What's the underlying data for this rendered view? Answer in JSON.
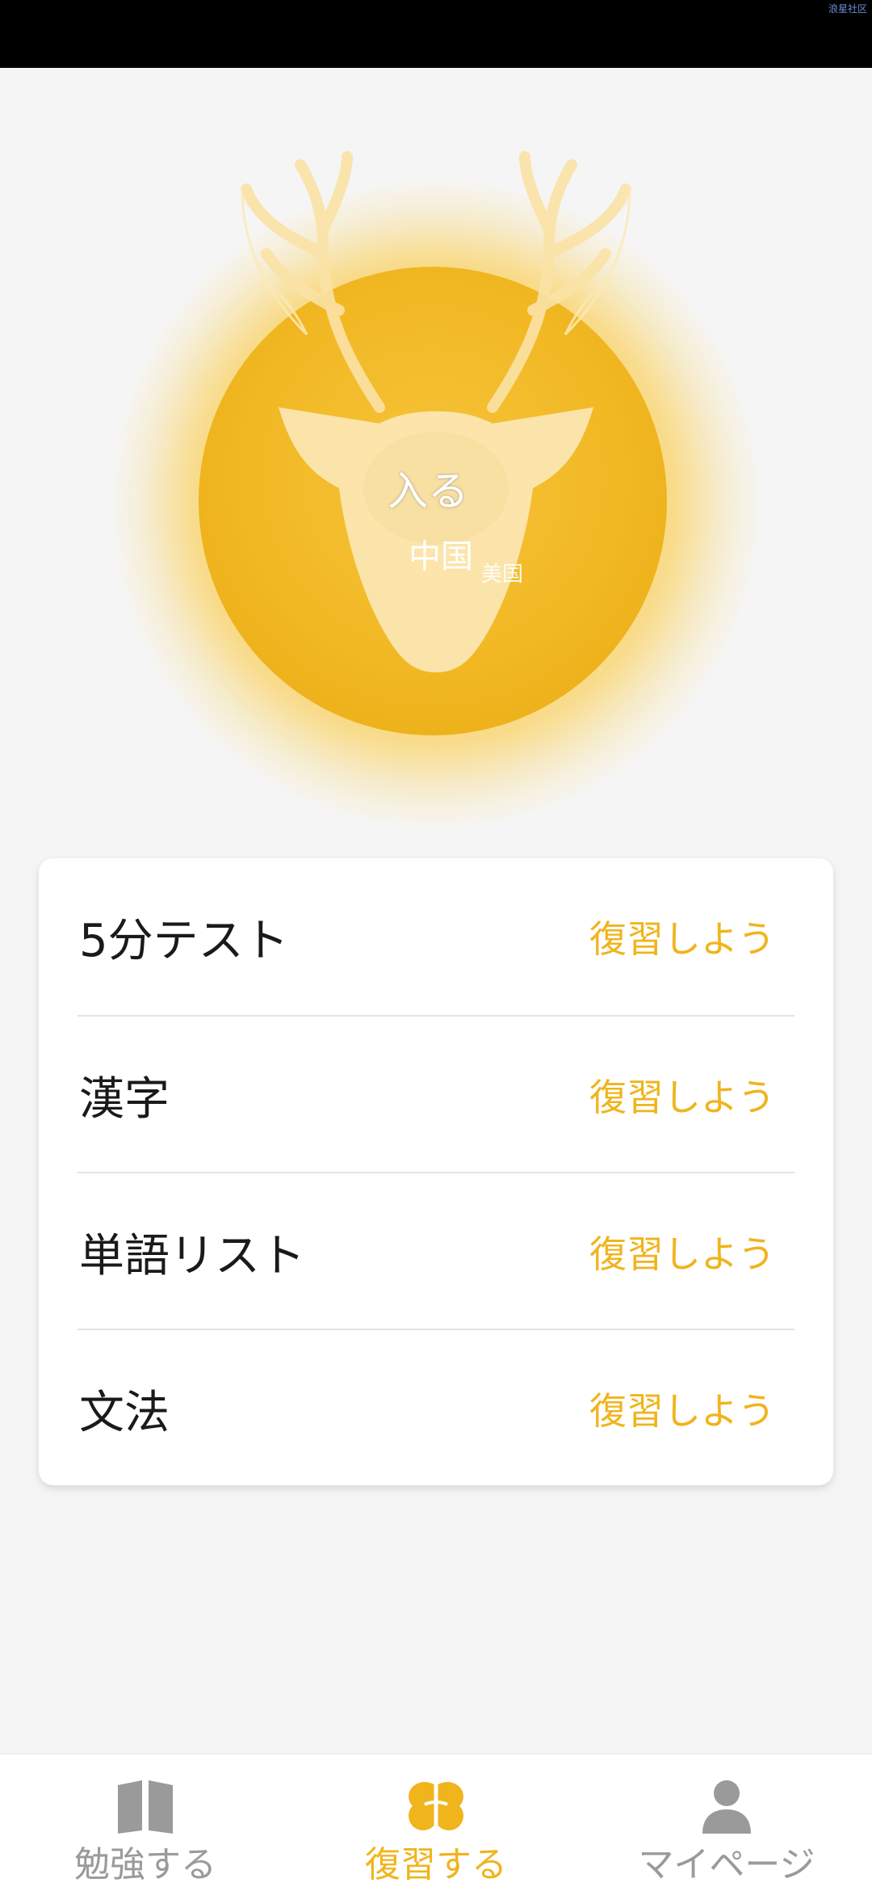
{
  "status_bar": {
    "corner_text": "浪星社区"
  },
  "hero": {
    "enter_label": "入る",
    "country_main": "中国",
    "country_sub": "美国",
    "accent_color": "#f0b41c"
  },
  "review_list": {
    "items": [
      {
        "label": "5分テスト",
        "action": "復習しよう"
      },
      {
        "label": "漢字",
        "action": "復習しよう"
      },
      {
        "label": "単語リスト",
        "action": "復習しよう"
      },
      {
        "label": "文法",
        "action": "復習しよう"
      }
    ]
  },
  "tabbar": {
    "tabs": [
      {
        "label": "勉強する",
        "icon": "book-icon",
        "active": false
      },
      {
        "label": "復習する",
        "icon": "brain-icon",
        "active": true
      },
      {
        "label": "マイページ",
        "icon": "user-icon",
        "active": false
      }
    ],
    "active_color": "#f0b41c",
    "inactive_color": "#9a9a9a"
  }
}
